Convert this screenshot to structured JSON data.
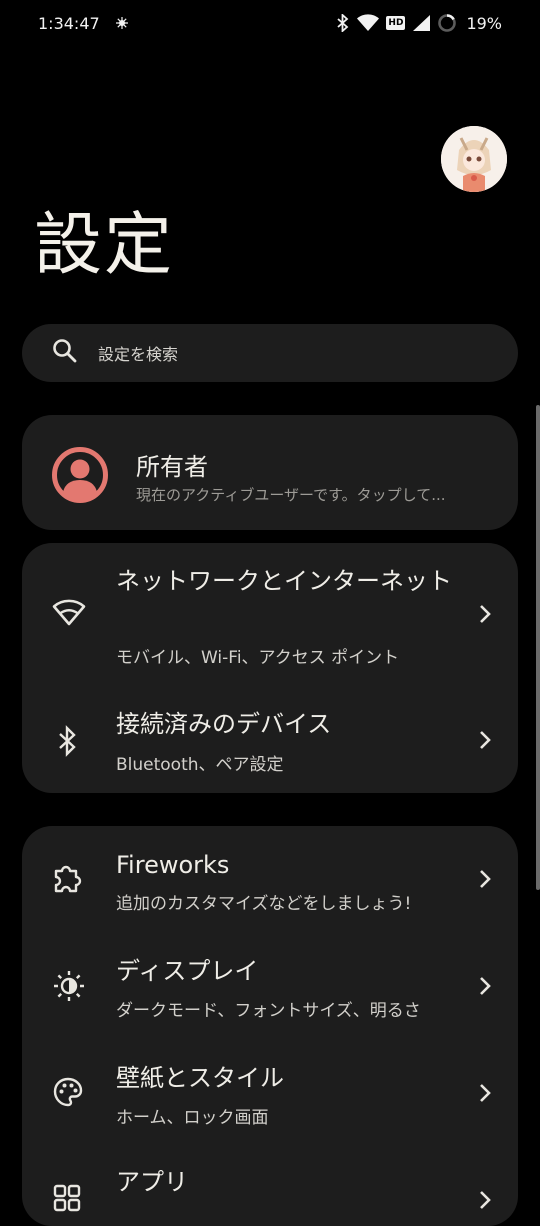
{
  "status_bar": {
    "time": "1:34:47",
    "hd_badge": "HD",
    "battery": "19%"
  },
  "page": {
    "title": "設定"
  },
  "search": {
    "placeholder": "設定を検索"
  },
  "owner": {
    "title": "所有者",
    "subtitle": "現在のアクティブユーザーです。タップして..."
  },
  "network_card": {
    "items": [
      {
        "title": "ネットワークとインターネット",
        "subtitle": "モバイル、Wi-Fi、アクセス ポイント",
        "icon": "wifi-icon"
      },
      {
        "title": "接続済みのデバイス",
        "subtitle": "Bluetooth、ペア設定",
        "icon": "bluetooth-icon"
      }
    ]
  },
  "apps_card": {
    "items": [
      {
        "title": "Fireworks",
        "subtitle": "追加のカスタマイズなどをしましょう!",
        "icon": "puzzle-icon"
      },
      {
        "title": "ディスプレイ",
        "subtitle": "ダークモード、フォントサイズ、明るさ",
        "icon": "brightness-icon"
      },
      {
        "title": "壁紙とスタイル",
        "subtitle": "ホーム、ロック画面",
        "icon": "palette-icon"
      },
      {
        "title": "アプリ",
        "subtitle": "",
        "icon": "apps-icon"
      }
    ]
  },
  "colors": {
    "background": "#000000",
    "card": "#1d1d1d",
    "owner_icon": "#e37870"
  }
}
